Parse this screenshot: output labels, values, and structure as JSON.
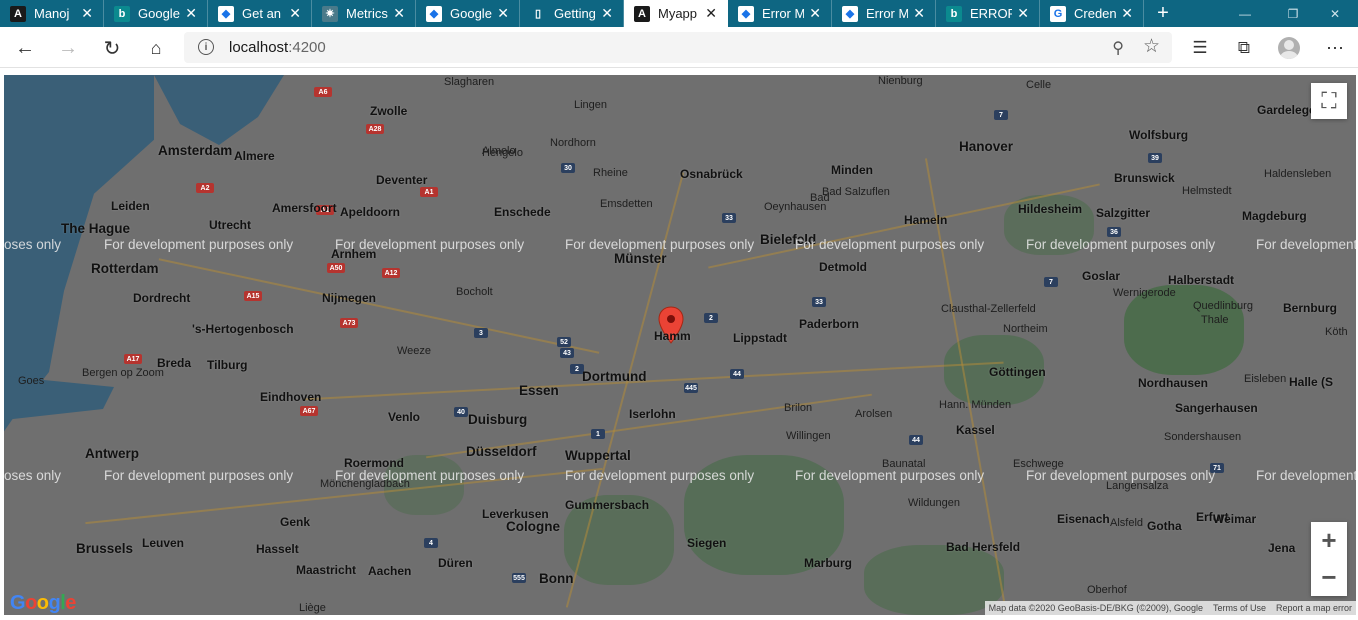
{
  "browser": {
    "tabs": [
      {
        "title": "Manoj",
        "icon": "angular-icon",
        "icon_char": "A",
        "icon_bg": "#1a1a1a",
        "active": false
      },
      {
        "title": "Google",
        "icon": "bing-icon",
        "icon_char": "b",
        "icon_bg": "#0b8a8f",
        "active": false
      },
      {
        "title": "Get an",
        "icon": "gcp-icon",
        "icon_char": "◆",
        "icon_bg": "#ffffff",
        "active": false
      },
      {
        "title": "Metrics",
        "icon": "metrics-icon",
        "icon_char": "✷",
        "icon_bg": "#4a7a8a",
        "active": false
      },
      {
        "title": "Google",
        "icon": "gcp-icon",
        "icon_char": "◆",
        "icon_bg": "#ffffff",
        "active": false
      },
      {
        "title": "Getting",
        "icon": "document-icon",
        "icon_char": "▯",
        "icon_bg": "transparent",
        "active": false
      },
      {
        "title": "Myapp",
        "icon": "angular-icon",
        "icon_char": "A",
        "icon_bg": "#1a1a1a",
        "active": true
      },
      {
        "title": "Error M",
        "icon": "gcp-icon",
        "icon_char": "◆",
        "icon_bg": "#ffffff",
        "active": false
      },
      {
        "title": "Error M",
        "icon": "gcp-icon",
        "icon_char": "◆",
        "icon_bg": "#ffffff",
        "active": false
      },
      {
        "title": "ERROR",
        "icon": "bing-icon",
        "icon_char": "b",
        "icon_bg": "#0b8a8f",
        "active": false
      },
      {
        "title": "Creden",
        "icon": "google-icon",
        "icon_char": "G",
        "icon_bg": "#ffffff",
        "active": false
      }
    ],
    "close_glyph": "✕",
    "new_tab_glyph": "+",
    "url_host": "localhost",
    "url_port": ":4200"
  },
  "map": {
    "pin_label": "Hamm",
    "watermark_text": "For development purposes only",
    "watermark_edge_left_1": "oses only",
    "watermark_edge_left_2": "ent",
    "watermark_edge_right": "For development",
    "attribution": {
      "data": "Map data ©2020 GeoBasis-DE/BKG (©2009), Google",
      "terms": "Terms of Use",
      "report": "Report a map error"
    },
    "logo": "Google",
    "zoom_in": "+",
    "zoom_out": "−",
    "cities": [
      {
        "name": "Amsterdam",
        "cls": "city big"
      },
      {
        "name": "The Hague",
        "cls": "city big"
      },
      {
        "name": "Rotterdam",
        "cls": "city big"
      },
      {
        "name": "Antwerp",
        "cls": "city big"
      },
      {
        "name": "Brussels",
        "cls": "city big"
      },
      {
        "name": "Essen",
        "cls": "city big"
      },
      {
        "name": "Dortmund",
        "cls": "city big"
      },
      {
        "name": "Duisburg",
        "cls": "city big"
      },
      {
        "name": "Düsseldorf",
        "cls": "city big"
      },
      {
        "name": "Wuppertal",
        "cls": "city big"
      },
      {
        "name": "Cologne",
        "cls": "city big"
      },
      {
        "name": "Bonn",
        "cls": "city big"
      },
      {
        "name": "Münster",
        "cls": "city big"
      },
      {
        "name": "Bielefeld",
        "cls": "city big"
      },
      {
        "name": "Hanover",
        "cls": "city big"
      },
      {
        "name": "Eindhoven",
        "cls": "city"
      },
      {
        "name": "Utrecht",
        "cls": "city"
      },
      {
        "name": "Zwolle",
        "cls": "city"
      },
      {
        "name": "Almere",
        "cls": "city"
      },
      {
        "name": "Leiden",
        "cls": "city"
      },
      {
        "name": "Amersfoort",
        "cls": "city"
      },
      {
        "name": "Apeldoorn",
        "cls": "city"
      },
      {
        "name": "Deventer",
        "cls": "city"
      },
      {
        "name": "Enschede",
        "cls": "city"
      },
      {
        "name": "Arnhem",
        "cls": "city"
      },
      {
        "name": "Nijmegen",
        "cls": "city"
      },
      {
        "name": "'s-Hertogenbosch",
        "cls": "city"
      },
      {
        "name": "Tilburg",
        "cls": "city"
      },
      {
        "name": "Breda",
        "cls": "city"
      },
      {
        "name": "Dordrecht",
        "cls": "city"
      },
      {
        "name": "Osnabrück",
        "cls": "city"
      },
      {
        "name": "Paderborn",
        "cls": "city"
      },
      {
        "name": "Kassel",
        "cls": "city"
      },
      {
        "name": "Göttingen",
        "cls": "city"
      },
      {
        "name": "Wolfsburg",
        "cls": "city"
      },
      {
        "name": "Brunswick",
        "cls": "city"
      },
      {
        "name": "Hildesheim",
        "cls": "city"
      },
      {
        "name": "Salzgitter",
        "cls": "city"
      },
      {
        "name": "Magdeburg",
        "cls": "city"
      },
      {
        "name": "Halberstadt",
        "cls": "city"
      },
      {
        "name": "Siegen",
        "cls": "city"
      },
      {
        "name": "Marburg",
        "cls": "city"
      },
      {
        "name": "Erfurt",
        "cls": "city"
      },
      {
        "name": "Gotha",
        "cls": "city"
      },
      {
        "name": "Eisenach",
        "cls": "city"
      },
      {
        "name": "Bad Hersfeld",
        "cls": "city"
      },
      {
        "name": "Aachen",
        "cls": "city"
      },
      {
        "name": "Maastricht",
        "cls": "city"
      },
      {
        "name": "Leuven",
        "cls": "city"
      },
      {
        "name": "Hasselt",
        "cls": "city"
      },
      {
        "name": "Genk",
        "cls": "city"
      },
      {
        "name": "Venlo",
        "cls": "city"
      },
      {
        "name": "Roermond",
        "cls": "city"
      },
      {
        "name": "Lippstadt",
        "cls": "city"
      },
      {
        "name": "Iserlohn",
        "cls": "city"
      },
      {
        "name": "Leverkusen",
        "cls": "city"
      },
      {
        "name": "Gummersbach",
        "cls": "city"
      },
      {
        "name": "Düren",
        "cls": "city"
      },
      {
        "name": "Mönchengladbach",
        "cls": "town"
      },
      {
        "name": "Detmold",
        "cls": "city"
      },
      {
        "name": "Minden",
        "cls": "city"
      },
      {
        "name": "Hameln",
        "cls": "city"
      },
      {
        "name": "Goslar",
        "cls": "city"
      },
      {
        "name": "Nordhausen",
        "cls": "city"
      },
      {
        "name": "Sangerhausen",
        "cls": "city"
      },
      {
        "name": "Weimar",
        "cls": "city"
      },
      {
        "name": "Jena",
        "cls": "city"
      },
      {
        "name": "Halle (S",
        "cls": "city"
      },
      {
        "name": "Bernburg",
        "cls": "city"
      },
      {
        "name": "Gardelegen",
        "cls": "city"
      },
      {
        "name": "Celle",
        "cls": "town"
      },
      {
        "name": "Nienburg",
        "cls": "town"
      },
      {
        "name": "Lingen",
        "cls": "town"
      },
      {
        "name": "Nordhorn",
        "cls": "town"
      },
      {
        "name": "Rheine",
        "cls": "town"
      },
      {
        "name": "Hengelo",
        "cls": "town"
      },
      {
        "name": "Almelo",
        "cls": "town"
      },
      {
        "name": "Emsdetten",
        "cls": "town"
      },
      {
        "name": "Bocholt",
        "cls": "town"
      },
      {
        "name": "Weeze",
        "cls": "town"
      },
      {
        "name": "Bad Salzuflen",
        "cls": "town"
      },
      {
        "name": "Oeynhausen",
        "cls": "town"
      },
      {
        "name": "Bad",
        "cls": "town"
      },
      {
        "name": "Brilon",
        "cls": "town"
      },
      {
        "name": "Arolsen",
        "cls": "town"
      },
      {
        "name": "Willingen",
        "cls": "town"
      },
      {
        "name": "Baunatal",
        "cls": "town"
      },
      {
        "name": "Wildungen",
        "cls": "town"
      },
      {
        "name": "Hann. Münden",
        "cls": "town"
      },
      {
        "name": "Eschwege",
        "cls": "town"
      },
      {
        "name": "Sondershausen",
        "cls": "town"
      },
      {
        "name": "Langensalza",
        "cls": "town"
      },
      {
        "name": "Alsfeld",
        "cls": "town"
      },
      {
        "name": "Oberhof",
        "cls": "town"
      },
      {
        "name": "Wernigerode",
        "cls": "town"
      },
      {
        "name": "Quedlinburg",
        "cls": "town"
      },
      {
        "name": "Thale",
        "cls": "town"
      },
      {
        "name": "Clausthal-Zellerfeld",
        "cls": "town"
      },
      {
        "name": "Northeim",
        "cls": "town"
      },
      {
        "name": "Eisleben",
        "cls": "town"
      },
      {
        "name": "Helmstedt",
        "cls": "town"
      },
      {
        "name": "Haldensleben",
        "cls": "town"
      },
      {
        "name": "Slagharen",
        "cls": "town"
      },
      {
        "name": "Goes",
        "cls": "town"
      },
      {
        "name": "Bergen op Zoom",
        "cls": "town"
      },
      {
        "name": "Liège",
        "cls": "town"
      },
      {
        "name": "Köth",
        "cls": "town"
      }
    ]
  }
}
